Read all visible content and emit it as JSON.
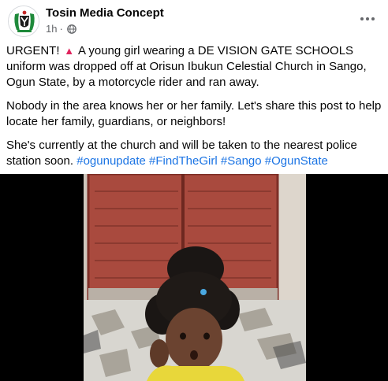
{
  "post": {
    "author": "Tosin Media Concept",
    "time": "1h",
    "dot": "·",
    "icons": {
      "avatar": "nigeria-coat-of-arms-logo",
      "privacy": "globe-icon",
      "menu": "more-options-icon",
      "alert": "siren-emoji"
    },
    "paragraphs": {
      "p1_lead": "URGENT!",
      "p1_rest": "A young girl wearing a DE VISION GATE SCHOOLS uniform was dropped off at Orisun Ibukun Celestial Church in Sango, Ogun State, by a motorcycle rider and ran away.",
      "p2": "Nobody in the area knows her or her family. Let's share this post to help locate her family, guardians, or neighbors!",
      "p3": "She's currently at the church and will be taken to the nearest police station soon."
    },
    "hashtags": [
      "#ogunupdate",
      "#FindTheGirl",
      "#Sango",
      "#OgunState"
    ],
    "colors": {
      "text": "#050505",
      "meta": "#65676b",
      "link": "#1b74e4",
      "media_bg": "#000000"
    }
  }
}
